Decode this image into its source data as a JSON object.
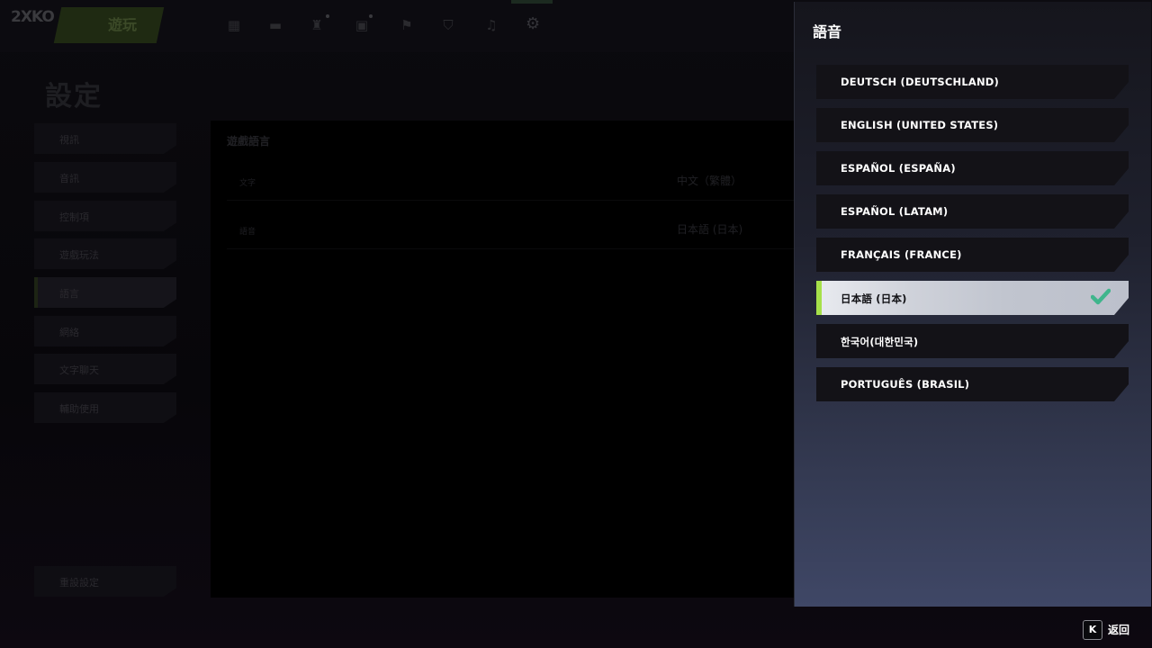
{
  "app": {
    "logo_text": "2XKO"
  },
  "nav": {
    "active_label": "遊玩",
    "icons": [
      "grid-icon",
      "minus-icon",
      "trophy-icon",
      "card-icon",
      "flag-icon",
      "shield-icon",
      "bell-icon",
      "gear-icon"
    ]
  },
  "page": {
    "title": "設定"
  },
  "sidebar": {
    "items": [
      {
        "label": "視訊"
      },
      {
        "label": "音訊"
      },
      {
        "label": "控制項"
      },
      {
        "label": "遊戲玩法"
      },
      {
        "label": "語言"
      },
      {
        "label": "網絡"
      },
      {
        "label": "文字聊天"
      },
      {
        "label": "輔助使用"
      }
    ],
    "footer_item": "重設設定"
  },
  "settings_panel": {
    "title": "遊戲語言",
    "rows": [
      {
        "label": "文字",
        "value": "中文（繁體）"
      },
      {
        "label": "語音",
        "value": "日本語 (日本)"
      }
    ]
  },
  "language_panel": {
    "title": "語音",
    "options": [
      {
        "label": "DEUTSCH (DEUTSCHLAND)",
        "selected": false
      },
      {
        "label": "ENGLISH (UNITED STATES)",
        "selected": false
      },
      {
        "label": "ESPAÑOL (ESPAÑA)",
        "selected": false
      },
      {
        "label": "ESPAÑOL (LATAM)",
        "selected": false
      },
      {
        "label": "FRANÇAIS (FRANCE)",
        "selected": false
      },
      {
        "label": "日本語 (日本)",
        "selected": true
      },
      {
        "label": "한국어(대한민국)",
        "selected": false
      },
      {
        "label": "PORTUGUÊS (BRASIL)",
        "selected": false
      }
    ],
    "selected_accent": "#a6e04a",
    "check_color": "#3fb58c"
  },
  "footer": {
    "back_key": "K",
    "back_label": "返回"
  }
}
